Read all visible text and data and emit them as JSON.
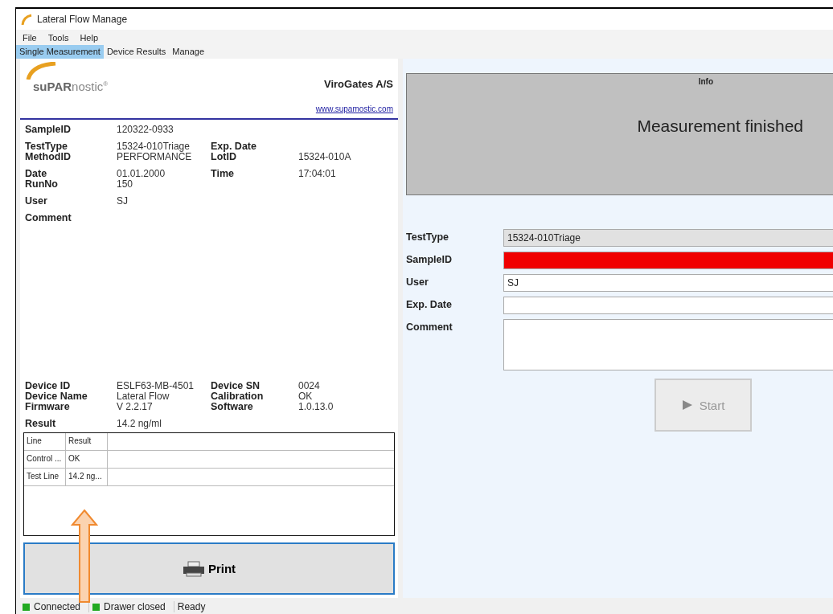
{
  "window": {
    "title": "Lateral Flow Manage"
  },
  "menu": [
    "File",
    "Tools",
    "Help"
  ],
  "tabs": [
    {
      "label": "Single Measurement",
      "selected": true
    },
    {
      "label": "Device Results",
      "selected": false
    },
    {
      "label": "Manage",
      "selected": false
    }
  ],
  "report": {
    "logo": {
      "bold": "suPAR",
      "light": "nostic",
      "mark": "®"
    },
    "company": "ViroGates A/S",
    "link": "www.supamostic.com",
    "groups": [
      [
        {
          "label": "SampleID",
          "value": "120322-0933"
        }
      ],
      [
        {
          "label": "TestType",
          "value": "15324-010Triage",
          "label2": "Exp. Date"
        },
        {
          "label": "MethodID",
          "value": "PERFORMANCE",
          "label2": "LotID",
          "value2": "15324-010A"
        }
      ],
      [
        {
          "label": "Date",
          "value": "01.01.2000",
          "label2": "Time",
          "value2": "17:04:01"
        },
        {
          "label": "RunNo",
          "value": "150"
        }
      ],
      [
        {
          "label": "User",
          "value": "SJ"
        }
      ],
      [
        {
          "label": "Comment"
        }
      ]
    ],
    "device": [
      {
        "label": "Device ID",
        "value": "ESLF63-MB-4501",
        "label2": "Device SN",
        "value2": "0024"
      },
      {
        "label": "Device Name",
        "value": "Lateral Flow",
        "label2": "Calibration",
        "value2": "OK"
      },
      {
        "label": "Firmware",
        "value": "V 2.2.17",
        "label2": "Software",
        "value2": "1.0.13.0"
      }
    ],
    "result": {
      "label": "Result",
      "value": "14.2 ng/ml"
    },
    "table": {
      "columns": [
        "Line",
        "Result"
      ],
      "rows": [
        [
          "Control ...",
          "OK"
        ],
        [
          "Test Line",
          "14.2 ng..."
        ]
      ]
    },
    "print_button": "Print"
  },
  "info": {
    "title": "Info",
    "message": "Measurement finished"
  },
  "form": [
    {
      "label": "TestType",
      "value": "15324-010Triage",
      "kind": "readonly"
    },
    {
      "label": "SampleID",
      "kind": "invalid"
    },
    {
      "label": "User",
      "value": "SJ",
      "kind": "text"
    },
    {
      "label": "Exp. Date",
      "kind": "text"
    },
    {
      "label": "Comment",
      "kind": "multiline"
    }
  ],
  "start_button": {
    "label": "Start",
    "disabled": true
  },
  "status_bar": [
    {
      "kind": "led",
      "label": "Connected",
      "on": true
    },
    {
      "kind": "led",
      "label": "Drawer closed",
      "on": true
    },
    {
      "kind": "text",
      "label": "Ready"
    }
  ]
}
